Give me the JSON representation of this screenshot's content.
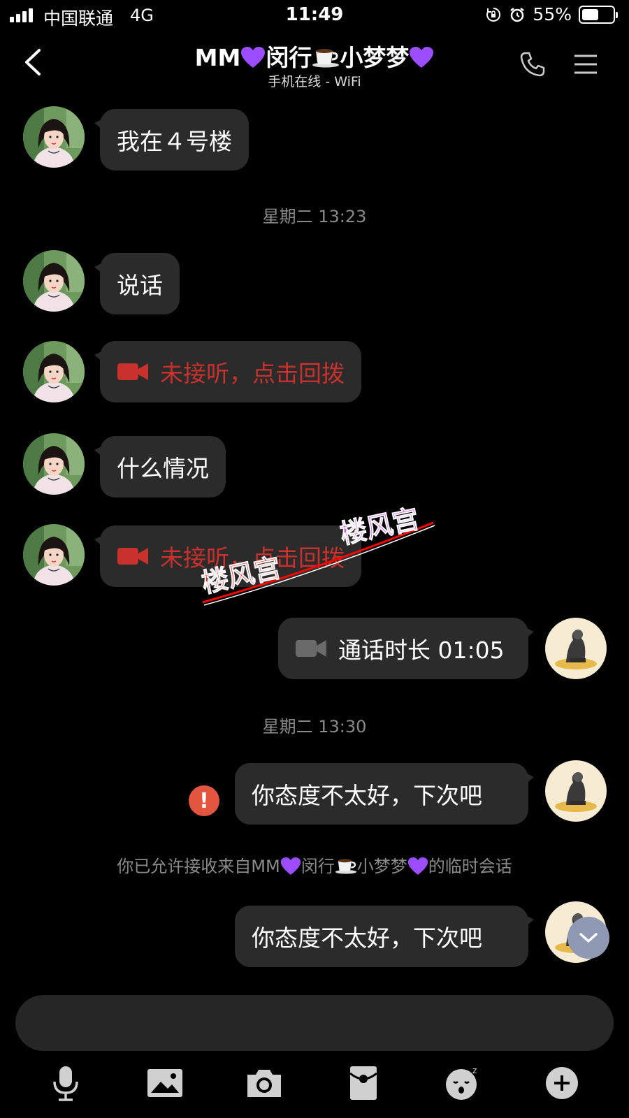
{
  "status_bar": {
    "carrier": "中国联通",
    "network": "4G",
    "time": "11:49",
    "battery_percent": "55%",
    "battery_level": 0.55
  },
  "header": {
    "title_parts": [
      "MM",
      "闵行",
      "小梦梦"
    ],
    "subtitle": "手机在线 - WiFi"
  },
  "messages": {
    "m1": "我在４号楼",
    "ts1": "星期二 13:23",
    "m2": "说话",
    "m3": "未接听，点击回拨",
    "m4": "什么情况",
    "m5": "未接听，点击回拨",
    "m6": "通话时长 01:05",
    "ts2": "星期二 13:30",
    "m7": "你态度不太好，下次吧",
    "error_mark": "!",
    "system_parts": [
      "你已允许接收来自MM",
      "闵行",
      "小梦梦",
      "的临时会话"
    ],
    "m8": "你态度不太好，下次吧"
  },
  "watermark": {
    "text": "楼风宫"
  },
  "icons": {
    "back": "chevron-left-icon",
    "phone": "phone-icon",
    "menu": "menu-icon",
    "video": "video-camera-icon",
    "heart": "purple-heart-icon",
    "cup": "coffee-cup-icon",
    "scroll": "chevron-down-icon",
    "toolbar": [
      "microphone-icon",
      "image-icon",
      "camera-icon",
      "red-packet-icon",
      "emoji-icon",
      "plus-icon"
    ]
  },
  "colors": {
    "missed_call": "#c9312d",
    "error": "#e2553f",
    "bubble": "#2b2b2b",
    "heart": "#9b4dff"
  }
}
